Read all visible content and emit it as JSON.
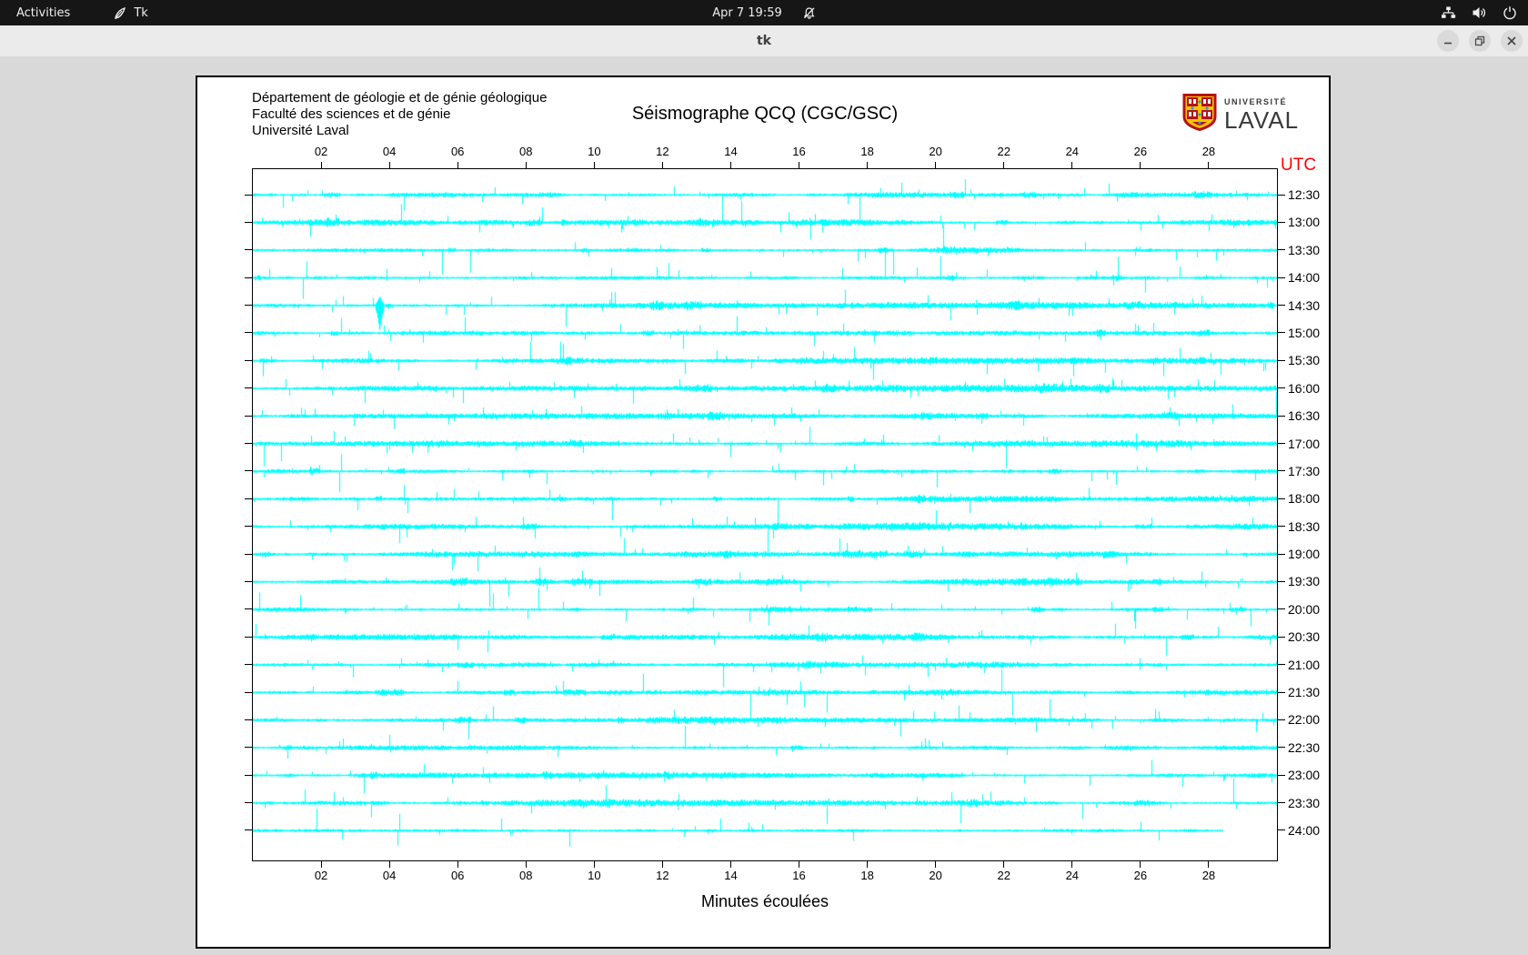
{
  "topbar": {
    "activities_label": "Activities",
    "app_indicator": "Tk",
    "clock": "Apr 7 19:59",
    "icons": [
      "tk-icon",
      "bell-muted-icon",
      "network-icon",
      "volume-icon",
      "power-icon"
    ]
  },
  "window": {
    "title": "tk",
    "controls": [
      "minimize",
      "maximize",
      "close"
    ]
  },
  "app": {
    "header_lines": [
      "Département de géologie et de génie géologique",
      "Faculté des sciences et de génie",
      "Université Laval"
    ],
    "title": "Séismographe QCQ (CGC/GSC)",
    "logo": {
      "top": "UNIVERSITÉ",
      "bottom": "LAVAL"
    },
    "utc_label": "UTC",
    "utc_color": "#ff0000",
    "xlabel": "Minutes écoulées"
  },
  "chart_data": {
    "type": "line",
    "subtype": "seismograph-helicorder",
    "station": "QCQ (CGC/GSC)",
    "title": "Séismographe QCQ (CGC/GSC)",
    "xlabel": "Minutes écoulées",
    "x_range_minutes": [
      0,
      30
    ],
    "x_ticks": [
      "02",
      "04",
      "06",
      "08",
      "10",
      "12",
      "14",
      "16",
      "18",
      "20",
      "22",
      "24",
      "26",
      "28"
    ],
    "rows": 24,
    "minutes_per_row": 30,
    "row_labels_utc": [
      "12:30",
      "13:00",
      "13:30",
      "14:00",
      "14:30",
      "15:00",
      "15:30",
      "16:00",
      "16:30",
      "17:00",
      "17:30",
      "18:00",
      "18:30",
      "19:00",
      "19:30",
      "20:00",
      "20:30",
      "21:00",
      "21:30",
      "22:00",
      "22:30",
      "23:00",
      "23:30",
      "24:00"
    ],
    "utc_axis_label": "UTC",
    "trace_color": "#00ffff",
    "last_row_end_fraction": 0.948,
    "notable_event": {
      "row_label": "14:30",
      "minute": 3.7,
      "description": "large amplitude spike"
    },
    "grid": false,
    "legend": false
  }
}
